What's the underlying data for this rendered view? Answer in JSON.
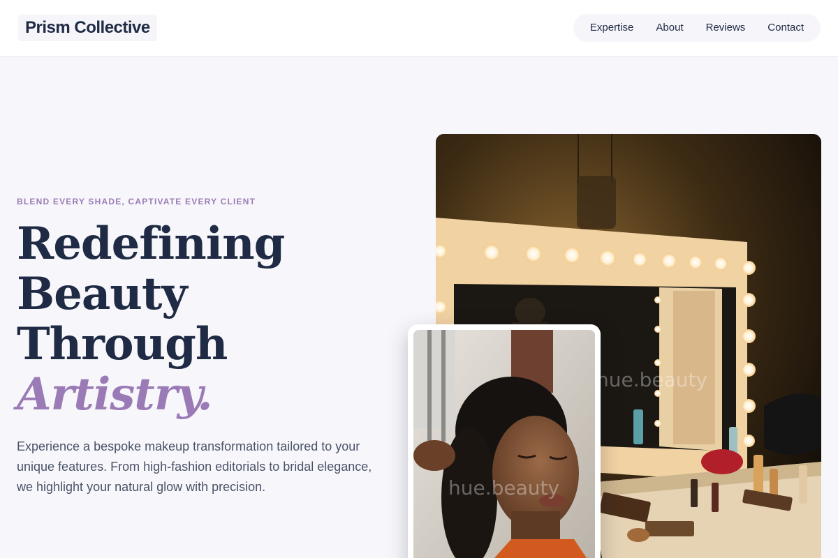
{
  "header": {
    "brand": "Prism Collective",
    "nav": [
      "Expertise",
      "About",
      "Reviews",
      "Contact"
    ]
  },
  "hero": {
    "eyebrow": "BLEND EVERY SHADE, CAPTIVATE EVERY CLIENT",
    "headline_lines": [
      "Redefining",
      "Beauty",
      "Through"
    ],
    "headline_accent": "Artistry.",
    "lead": "Experience a bespoke makeup transformation tailored to your unique features. From high-fashion editorials to bridal elegance, we highlight your natural glow with precision."
  },
  "images": {
    "main_alt": "Vanity mirror with lights and makeup",
    "small_alt": "Woman receiving makeup",
    "watermark": "hue.beauty"
  },
  "colors": {
    "accent": "#9b7bb6",
    "navy": "#1f2a44",
    "background": "#f7f7fb"
  }
}
